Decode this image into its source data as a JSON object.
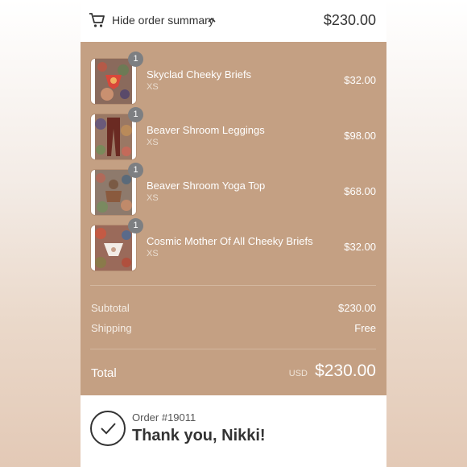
{
  "summary": {
    "toggle_label": "Hide order summary",
    "total": "$230.00"
  },
  "items": [
    {
      "name": "Skyclad Cheeky Briefs",
      "variant": "XS",
      "price": "$32.00",
      "qty": "1"
    },
    {
      "name": "Beaver Shroom Leggings",
      "variant": "XS",
      "price": "$98.00",
      "qty": "1"
    },
    {
      "name": "Beaver Shroom Yoga Top",
      "variant": "XS",
      "price": "$68.00",
      "qty": "1"
    },
    {
      "name": "Cosmic Mother Of All Cheeky Briefs",
      "variant": "XS",
      "price": "$32.00",
      "qty": "1"
    }
  ],
  "totals": {
    "subtotal_label": "Subtotal",
    "subtotal_value": "$230.00",
    "shipping_label": "Shipping",
    "shipping_value": "Free",
    "total_label": "Total",
    "currency": "USD",
    "total_value": "$230.00"
  },
  "confirmation": {
    "order_number": "Order #19011",
    "thanks": "Thank you, Nikki!"
  },
  "colors": {
    "panel": "#c4a083",
    "badge": "#7d7f82"
  }
}
